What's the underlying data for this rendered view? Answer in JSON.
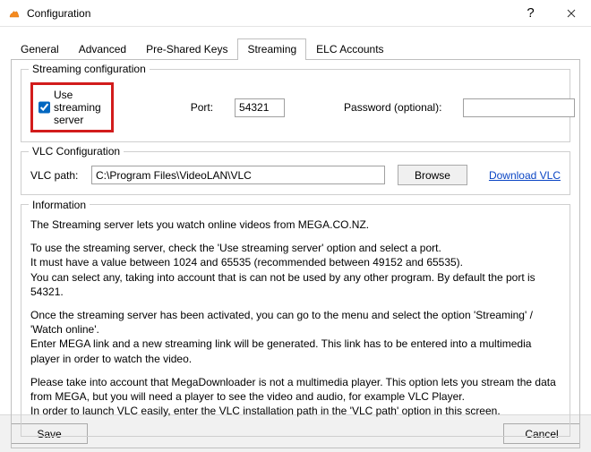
{
  "window": {
    "title": "Configuration"
  },
  "tabs": {
    "general": "General",
    "advanced": "Advanced",
    "preshared": "Pre-Shared Keys",
    "streaming": "Streaming",
    "elc": "ELC Accounts"
  },
  "streaming_group": {
    "legend": "Streaming configuration",
    "use_server_label": "Use streaming server",
    "use_server_checked": true,
    "port_label": "Port:",
    "port_value": "54321",
    "password_label": "Password (optional):",
    "password_value": ""
  },
  "vlc_group": {
    "legend": "VLC Configuration",
    "path_label": "VLC path:",
    "path_value": "C:\\Program Files\\VideoLAN\\VLC",
    "browse_label": "Browse",
    "download_label": "Download VLC"
  },
  "info_group": {
    "legend": "Information",
    "p1": "The Streaming server lets you watch online videos from MEGA.CO.NZ.",
    "p2a": "To use the streaming server, check the 'Use streaming server' option and select a port.",
    "p2b": "It must have a value between 1024 and 65535 (recommended between 49152 and 65535).",
    "p2c": "You can select any, taking into account that is can not be used by any other program. By default the port is 54321.",
    "p3a": "Once the streaming server has been activated, you can go to the menu and select the option 'Streaming' / 'Watch online'.",
    "p3b": "Enter MEGA link and a new streaming link will be generated. This link has to be entered into a multimedia player in order to watch the video.",
    "p4a": "Please take into account that MegaDownloader is not a multimedia player. This option lets you stream the data from MEGA, but you will need a player to see the video and audio, for example VLC Player.",
    "p4b": "In order to launch VLC easily, enter the VLC installation path in the 'VLC path' option in this screen."
  },
  "buttons": {
    "save": "Save",
    "cancel": "Cancel"
  }
}
